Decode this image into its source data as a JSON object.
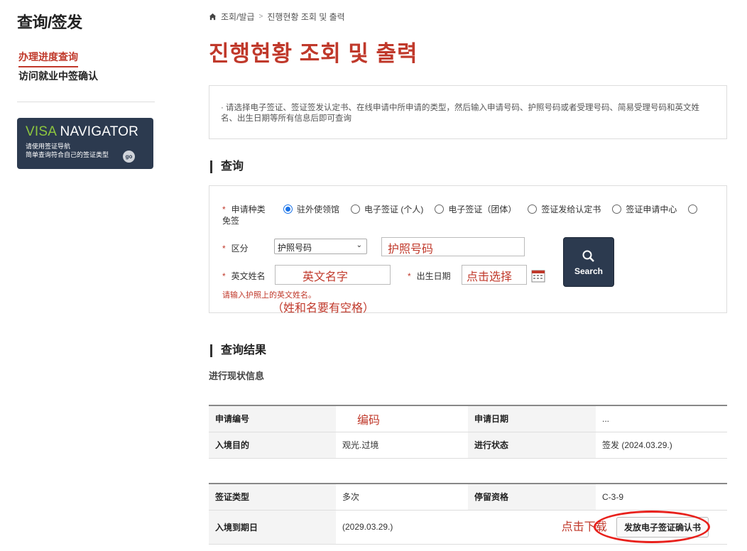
{
  "sidebar": {
    "title": "查询/签发",
    "nav_active": "办理进度查询",
    "nav_item": "访问就业中签确认",
    "visa_word": "VISA",
    "navigator_word": "NAVIGATOR",
    "visa_line1": "请使用签证导航",
    "visa_line2": "简单查询符合自己的签证类型",
    "visa_go": "go"
  },
  "breadcrumb": {
    "home": "조회/발급",
    "current": "진행현황 조회 및 출력"
  },
  "page_title": "진행현황 조회 및 출력",
  "notice": "· 请选择电子签证、签证签发认定书、在线申请中所申请的类型，然后输入申请号码、护照号码或者受理号码、简易受理号码和英文姓名、出生日期等所有信息后即可查询",
  "query": {
    "heading": "查询",
    "type_label_1": "申请种类",
    "type_label_2": "免签",
    "options": [
      "驻外使领馆",
      "电子签证 (个人)",
      "电子签证（团体）",
      "签证发给认定书",
      "签证申请中心"
    ],
    "division_label": "区分",
    "division_value": "护照号码",
    "passport_value": "护照号码",
    "name_label": "英文姓名",
    "name_value": "英文名字",
    "birth_label": "出生日期",
    "birth_value": "点击选择",
    "search_label": "Search",
    "hint": "请输入护照上的英文姓名。",
    "annotation_space": "（姓和名要有空格）"
  },
  "result": {
    "heading": "查询结果",
    "sub_heading": "进行现状信息",
    "table1": [
      [
        "申请编号",
        "编码",
        "申请日期",
        "..."
      ],
      [
        "入境目的",
        "观光.过境",
        "进行状态",
        "签发 (2024.03.29.)"
      ]
    ],
    "table2": [
      [
        "签证类型",
        "多次",
        "停留资格",
        "C-3-9"
      ],
      [
        "入境到期日",
        "(2029.03.29.)",
        "",
        ""
      ]
    ],
    "download_annotation": "点击下载",
    "download_button": "发放电子签证确认书"
  },
  "colors": {
    "accent_red": "#c0392b",
    "navy": "#2c3a4f",
    "visa_green": "#8dc63f",
    "radio_blue": "#1a73e8"
  }
}
